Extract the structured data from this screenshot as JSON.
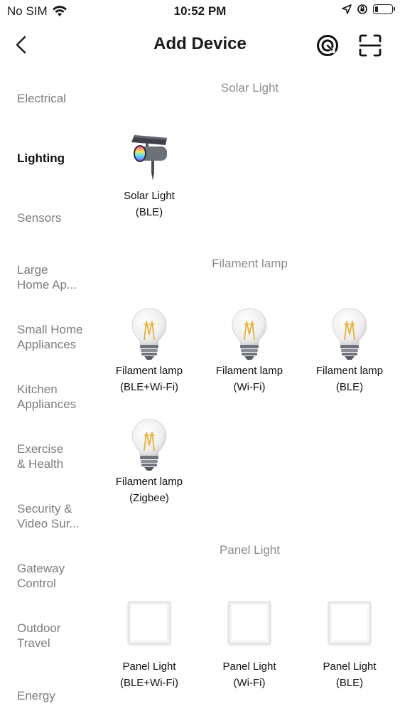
{
  "status": {
    "carrier": "No SIM",
    "time": "10:52 PM"
  },
  "header": {
    "title": "Add Device"
  },
  "sidebar": {
    "items": [
      {
        "line1": "Electrical",
        "line2": ""
      },
      {
        "line1": "Lighting",
        "line2": ""
      },
      {
        "line1": "Sensors",
        "line2": ""
      },
      {
        "line1": "Large",
        "line2": "Home Ap..."
      },
      {
        "line1": "Small Home",
        "line2": "Appliances"
      },
      {
        "line1": "Kitchen",
        "line2": "Appliances"
      },
      {
        "line1": "Exercise",
        "line2": "& Health"
      },
      {
        "line1": "Security &",
        "line2": "Video Sur..."
      },
      {
        "line1": "Gateway",
        "line2": "Control"
      },
      {
        "line1": "Outdoor",
        "line2": "Travel"
      },
      {
        "line1": "Energy",
        "line2": ""
      }
    ],
    "active_index": 1
  },
  "sections": [
    {
      "title": "Solar Light",
      "devices": [
        {
          "name": "Solar Light",
          "protocol": "(BLE)",
          "icon": "solar-light-icon"
        }
      ]
    },
    {
      "title": "Filament lamp",
      "devices": [
        {
          "name": "Filament lamp",
          "protocol": "(BLE+Wi-Fi)",
          "icon": "filament-bulb-icon"
        },
        {
          "name": "Filament lamp",
          "protocol": "(Wi-Fi)",
          "icon": "filament-bulb-icon"
        },
        {
          "name": "Filament lamp",
          "protocol": "(BLE)",
          "icon": "filament-bulb-icon"
        },
        {
          "name": "Filament lamp",
          "protocol": "(Zigbee)",
          "icon": "filament-bulb-icon"
        }
      ]
    },
    {
      "title": "Panel Light",
      "devices": [
        {
          "name": "Panel Light",
          "protocol": "(BLE+Wi-Fi)",
          "icon": "panel-light-icon"
        },
        {
          "name": "Panel Light",
          "protocol": "(Wi-Fi)",
          "icon": "panel-light-icon"
        },
        {
          "name": "Panel Light",
          "protocol": "(BLE)",
          "icon": "panel-light-icon"
        }
      ]
    }
  ],
  "icons": {
    "header_right": [
      "auto-discover-icon",
      "scan-qr-icon"
    ],
    "status_right": [
      "location-arrow-icon",
      "orientation-lock-icon",
      "battery-icon"
    ]
  },
  "battery_level": 0.2
}
